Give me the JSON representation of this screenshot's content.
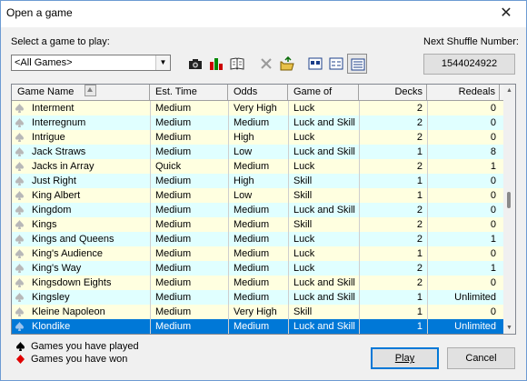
{
  "window": {
    "title": "Open a game",
    "close_glyph": "✕"
  },
  "select_label": "Select a game to play:",
  "filter": {
    "selected": "<All Games>",
    "arrow_glyph": "▼"
  },
  "toolbar": [
    {
      "name": "camera-icon",
      "pressed": false,
      "sep": false
    },
    {
      "name": "bar-chart-icon",
      "pressed": false,
      "sep": false
    },
    {
      "name": "book-icon",
      "pressed": false,
      "sep": false
    },
    {
      "name": "delete-icon",
      "pressed": false,
      "sep": true
    },
    {
      "name": "open-folder-icon",
      "pressed": false,
      "sep": false
    },
    {
      "name": "large-icons-view-icon",
      "pressed": false,
      "sep": true
    },
    {
      "name": "list-view-icon",
      "pressed": false,
      "sep": false
    },
    {
      "name": "details-view-icon",
      "pressed": true,
      "sep": false
    }
  ],
  "shuffle": {
    "label": "Next Shuffle Number:",
    "value": "1544024922"
  },
  "table": {
    "columns": [
      "Game Name",
      "Est. Time",
      "Odds",
      "Game of",
      "Decks",
      "Redeals"
    ],
    "rows": [
      {
        "name": "Interment",
        "time": "Medium",
        "odds": "Very High",
        "type": "Luck",
        "decks": "2",
        "redeals": "0"
      },
      {
        "name": "Interregnum",
        "time": "Medium",
        "odds": "Medium",
        "type": "Luck and Skill",
        "decks": "2",
        "redeals": "0"
      },
      {
        "name": "Intrigue",
        "time": "Medium",
        "odds": "High",
        "type": "Luck",
        "decks": "2",
        "redeals": "0"
      },
      {
        "name": "Jack Straws",
        "time": "Medium",
        "odds": "Low",
        "type": "Luck and Skill",
        "decks": "1",
        "redeals": "8"
      },
      {
        "name": "Jacks in Array",
        "time": "Quick",
        "odds": "Medium",
        "type": "Luck",
        "decks": "2",
        "redeals": "1"
      },
      {
        "name": "Just Right",
        "time": "Medium",
        "odds": "High",
        "type": "Skill",
        "decks": "1",
        "redeals": "0"
      },
      {
        "name": "King Albert",
        "time": "Medium",
        "odds": "Low",
        "type": "Skill",
        "decks": "1",
        "redeals": "0"
      },
      {
        "name": "Kingdom",
        "time": "Medium",
        "odds": "Medium",
        "type": "Luck and Skill",
        "decks": "2",
        "redeals": "0"
      },
      {
        "name": "Kings",
        "time": "Medium",
        "odds": "Medium",
        "type": "Skill",
        "decks": "2",
        "redeals": "0"
      },
      {
        "name": "Kings and Queens",
        "time": "Medium",
        "odds": "Medium",
        "type": "Luck",
        "decks": "2",
        "redeals": "1"
      },
      {
        "name": "King's Audience",
        "time": "Medium",
        "odds": "Medium",
        "type": "Luck",
        "decks": "1",
        "redeals": "0"
      },
      {
        "name": "King's Way",
        "time": "Medium",
        "odds": "Medium",
        "type": "Luck",
        "decks": "2",
        "redeals": "1"
      },
      {
        "name": "Kingsdown Eights",
        "time": "Medium",
        "odds": "Medium",
        "type": "Luck and Skill",
        "decks": "2",
        "redeals": "0"
      },
      {
        "name": "Kingsley",
        "time": "Medium",
        "odds": "Medium",
        "type": "Luck and Skill",
        "decks": "1",
        "redeals": "Unlimited"
      },
      {
        "name": "Kleine Napoleon",
        "time": "Medium",
        "odds": "Very High",
        "type": "Skill",
        "decks": "1",
        "redeals": "0"
      },
      {
        "name": "Klondike",
        "time": "Medium",
        "odds": "Medium",
        "type": "Luck and Skill",
        "decks": "1",
        "redeals": "Unlimited",
        "selected": true
      }
    ]
  },
  "legend": {
    "played": "Games you have played",
    "won": "Games you have won"
  },
  "buttons": {
    "play": "Play",
    "cancel": "Cancel"
  },
  "colors": {
    "row_a": "#ffffe0",
    "row_b": "#e0ffff",
    "selection": "#0078d7",
    "won_marker": "#e00000"
  }
}
